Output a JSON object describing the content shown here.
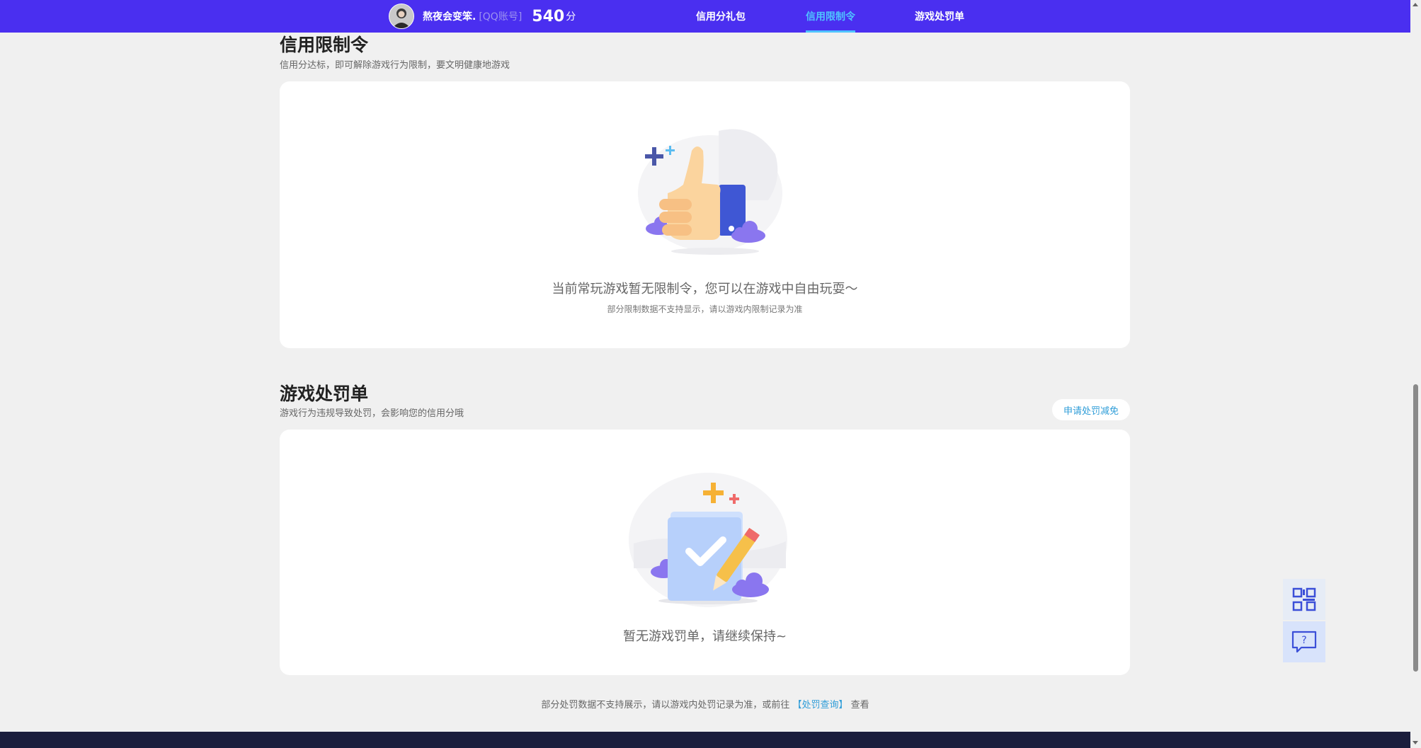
{
  "header": {
    "username": "熬夜会变笨.",
    "account_type": "[QQ账号]",
    "score": "540",
    "score_unit": "分",
    "nav": [
      {
        "label": "信用分礼包",
        "active": false
      },
      {
        "label": "信用限制令",
        "active": true
      },
      {
        "label": "游戏处罚单",
        "active": false
      }
    ],
    "accent": "#4a2ff0"
  },
  "restriction": {
    "title": "信用限制令",
    "subtitle": "信用分达标，即可解除游戏行为限制，要文明健康地游戏",
    "empty_text": "当前常玩游戏暂无限制令，您可以在游戏中自由玩耍～",
    "note": "部分限制数据不支持显示，请以游戏内限制记录为准"
  },
  "penalty": {
    "title": "游戏处罚单",
    "subtitle": "游戏行为违规导致处罚，会影响您的信用分哦",
    "apply_button": "申请处罚减免",
    "empty_text": "暂无游戏罚单，请继续保持~"
  },
  "footer": {
    "note_prefix": "部分处罚数据不支持展示，请以游戏内处罚记录为准，或前往",
    "link": "【处罚查询】",
    "note_suffix": "查看"
  },
  "side_tools": [
    "qrcode-icon",
    "help-chat-icon"
  ]
}
